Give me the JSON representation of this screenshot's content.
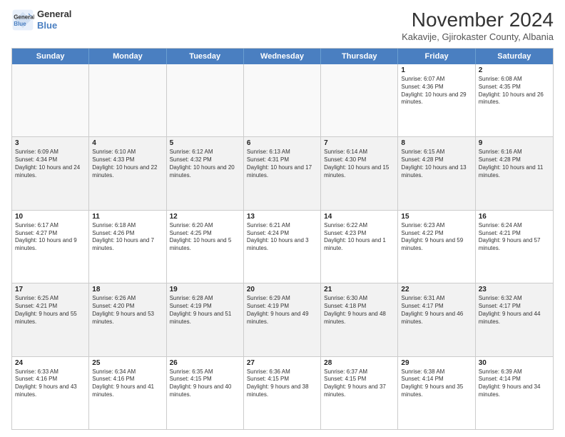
{
  "header": {
    "logo_line1": "General",
    "logo_line2": "Blue",
    "title": "November 2024",
    "subtitle": "Kakavije, Gjirokaster County, Albania"
  },
  "days_of_week": [
    "Sunday",
    "Monday",
    "Tuesday",
    "Wednesday",
    "Thursday",
    "Friday",
    "Saturday"
  ],
  "rows": [
    [
      {
        "day": "",
        "info": "",
        "empty": true
      },
      {
        "day": "",
        "info": "",
        "empty": true
      },
      {
        "day": "",
        "info": "",
        "empty": true
      },
      {
        "day": "",
        "info": "",
        "empty": true
      },
      {
        "day": "",
        "info": "",
        "empty": true
      },
      {
        "day": "1",
        "info": "Sunrise: 6:07 AM\nSunset: 4:36 PM\nDaylight: 10 hours and 29 minutes."
      },
      {
        "day": "2",
        "info": "Sunrise: 6:08 AM\nSunset: 4:35 PM\nDaylight: 10 hours and 26 minutes."
      }
    ],
    [
      {
        "day": "3",
        "info": "Sunrise: 6:09 AM\nSunset: 4:34 PM\nDaylight: 10 hours and 24 minutes.",
        "shaded": true
      },
      {
        "day": "4",
        "info": "Sunrise: 6:10 AM\nSunset: 4:33 PM\nDaylight: 10 hours and 22 minutes.",
        "shaded": true
      },
      {
        "day": "5",
        "info": "Sunrise: 6:12 AM\nSunset: 4:32 PM\nDaylight: 10 hours and 20 minutes.",
        "shaded": true
      },
      {
        "day": "6",
        "info": "Sunrise: 6:13 AM\nSunset: 4:31 PM\nDaylight: 10 hours and 17 minutes.",
        "shaded": true
      },
      {
        "day": "7",
        "info": "Sunrise: 6:14 AM\nSunset: 4:30 PM\nDaylight: 10 hours and 15 minutes.",
        "shaded": true
      },
      {
        "day": "8",
        "info": "Sunrise: 6:15 AM\nSunset: 4:28 PM\nDaylight: 10 hours and 13 minutes.",
        "shaded": true
      },
      {
        "day": "9",
        "info": "Sunrise: 6:16 AM\nSunset: 4:28 PM\nDaylight: 10 hours and 11 minutes.",
        "shaded": true
      }
    ],
    [
      {
        "day": "10",
        "info": "Sunrise: 6:17 AM\nSunset: 4:27 PM\nDaylight: 10 hours and 9 minutes."
      },
      {
        "day": "11",
        "info": "Sunrise: 6:18 AM\nSunset: 4:26 PM\nDaylight: 10 hours and 7 minutes."
      },
      {
        "day": "12",
        "info": "Sunrise: 6:20 AM\nSunset: 4:25 PM\nDaylight: 10 hours and 5 minutes."
      },
      {
        "day": "13",
        "info": "Sunrise: 6:21 AM\nSunset: 4:24 PM\nDaylight: 10 hours and 3 minutes."
      },
      {
        "day": "14",
        "info": "Sunrise: 6:22 AM\nSunset: 4:23 PM\nDaylight: 10 hours and 1 minute."
      },
      {
        "day": "15",
        "info": "Sunrise: 6:23 AM\nSunset: 4:22 PM\nDaylight: 9 hours and 59 minutes."
      },
      {
        "day": "16",
        "info": "Sunrise: 6:24 AM\nSunset: 4:21 PM\nDaylight: 9 hours and 57 minutes."
      }
    ],
    [
      {
        "day": "17",
        "info": "Sunrise: 6:25 AM\nSunset: 4:21 PM\nDaylight: 9 hours and 55 minutes.",
        "shaded": true
      },
      {
        "day": "18",
        "info": "Sunrise: 6:26 AM\nSunset: 4:20 PM\nDaylight: 9 hours and 53 minutes.",
        "shaded": true
      },
      {
        "day": "19",
        "info": "Sunrise: 6:28 AM\nSunset: 4:19 PM\nDaylight: 9 hours and 51 minutes.",
        "shaded": true
      },
      {
        "day": "20",
        "info": "Sunrise: 6:29 AM\nSunset: 4:19 PM\nDaylight: 9 hours and 49 minutes.",
        "shaded": true
      },
      {
        "day": "21",
        "info": "Sunrise: 6:30 AM\nSunset: 4:18 PM\nDaylight: 9 hours and 48 minutes.",
        "shaded": true
      },
      {
        "day": "22",
        "info": "Sunrise: 6:31 AM\nSunset: 4:17 PM\nDaylight: 9 hours and 46 minutes.",
        "shaded": true
      },
      {
        "day": "23",
        "info": "Sunrise: 6:32 AM\nSunset: 4:17 PM\nDaylight: 9 hours and 44 minutes.",
        "shaded": true
      }
    ],
    [
      {
        "day": "24",
        "info": "Sunrise: 6:33 AM\nSunset: 4:16 PM\nDaylight: 9 hours and 43 minutes."
      },
      {
        "day": "25",
        "info": "Sunrise: 6:34 AM\nSunset: 4:16 PM\nDaylight: 9 hours and 41 minutes."
      },
      {
        "day": "26",
        "info": "Sunrise: 6:35 AM\nSunset: 4:15 PM\nDaylight: 9 hours and 40 minutes."
      },
      {
        "day": "27",
        "info": "Sunrise: 6:36 AM\nSunset: 4:15 PM\nDaylight: 9 hours and 38 minutes."
      },
      {
        "day": "28",
        "info": "Sunrise: 6:37 AM\nSunset: 4:15 PM\nDaylight: 9 hours and 37 minutes."
      },
      {
        "day": "29",
        "info": "Sunrise: 6:38 AM\nSunset: 4:14 PM\nDaylight: 9 hours and 35 minutes."
      },
      {
        "day": "30",
        "info": "Sunrise: 6:39 AM\nSunset: 4:14 PM\nDaylight: 9 hours and 34 minutes."
      }
    ]
  ]
}
